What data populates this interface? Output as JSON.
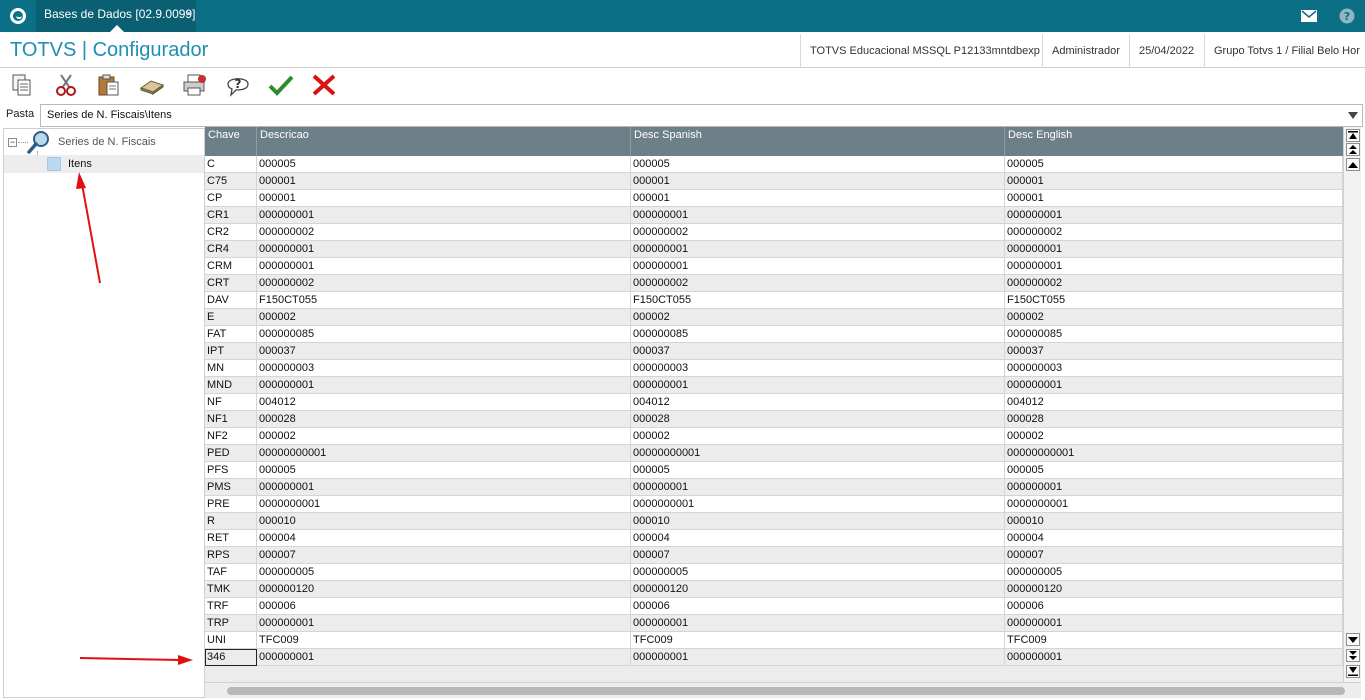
{
  "top_tab": {
    "label": "Bases de Dados [02.9.0099]",
    "close": "×"
  },
  "header": {
    "title": "TOTVS | Configurador",
    "environment": "TOTVS Educacional MSSQL P12133mntdbexp",
    "user": "Administrador",
    "date": "25/04/2022",
    "company": "Grupo Totvs 1 / Filial Belo Hor"
  },
  "toolbar": {
    "buttons": [
      "copy-icon",
      "cut-icon",
      "paste-icon",
      "eraser-icon",
      "print-icon",
      "help-icon",
      "confirm-icon",
      "cancel-icon"
    ]
  },
  "pasta": {
    "label": "Pasta",
    "value": "Series de N. Fiscais\\Itens"
  },
  "tree": {
    "root_label": "Series de N. Fiscais",
    "expander": "−",
    "child_label": "Itens"
  },
  "grid": {
    "columns": [
      "Chave",
      "Descricao",
      "Desc Spanish",
      "Desc English"
    ],
    "rows": [
      [
        "C",
        "000005",
        "000005",
        "000005"
      ],
      [
        "C75",
        "000001",
        "000001",
        "000001"
      ],
      [
        "CP",
        "000001",
        "000001",
        "000001"
      ],
      [
        "CR1",
        "000000001",
        "000000001",
        "000000001"
      ],
      [
        "CR2",
        "000000002",
        "000000002",
        "000000002"
      ],
      [
        "CR4",
        "000000001",
        "000000001",
        "000000001"
      ],
      [
        "CRM",
        "000000001",
        "000000001",
        "000000001"
      ],
      [
        "CRT",
        "000000002",
        "000000002",
        "000000002"
      ],
      [
        "DAV",
        "F150CT055",
        "F150CT055",
        "F150CT055"
      ],
      [
        "E",
        "000002",
        "000002",
        "000002"
      ],
      [
        "FAT",
        "000000085",
        "000000085",
        "000000085"
      ],
      [
        "IPT",
        "000037",
        "000037",
        "000037"
      ],
      [
        "MN",
        "000000003",
        "000000003",
        "000000003"
      ],
      [
        "MND",
        "000000001",
        "000000001",
        "000000001"
      ],
      [
        "NF",
        "004012",
        "004012",
        "004012"
      ],
      [
        "NF1",
        "000028",
        "000028",
        "000028"
      ],
      [
        "NF2",
        "000002",
        "000002",
        "000002"
      ],
      [
        "PED",
        "00000000001",
        "00000000001",
        "00000000001"
      ],
      [
        "PFS",
        "000005",
        "000005",
        "000005"
      ],
      [
        "PMS",
        "000000001",
        "000000001",
        "000000001"
      ],
      [
        "PRE",
        "0000000001",
        "0000000001",
        "0000000001"
      ],
      [
        "R",
        "000010",
        "000010",
        "000010"
      ],
      [
        "RET",
        "000004",
        "000004",
        "000004"
      ],
      [
        "RPS",
        "000007",
        "000007",
        "000007"
      ],
      [
        "TAF",
        "000000005",
        "000000005",
        "000000005"
      ],
      [
        "TMK",
        "000000120",
        "000000120",
        "000000120"
      ],
      [
        "TRF",
        "000006",
        "000006",
        "000006"
      ],
      [
        "TRP",
        "000000001",
        "000000001",
        "000000001"
      ],
      [
        "UNI",
        "TFC009",
        "TFC009",
        "TFC009"
      ],
      [
        "346",
        "000000001",
        "000000001",
        "000000001"
      ]
    ]
  },
  "colors": {
    "topbar": "#0b6f86",
    "title": "#1f8fb4",
    "grid_header": "#6e8087",
    "annotation": "#e01010"
  }
}
